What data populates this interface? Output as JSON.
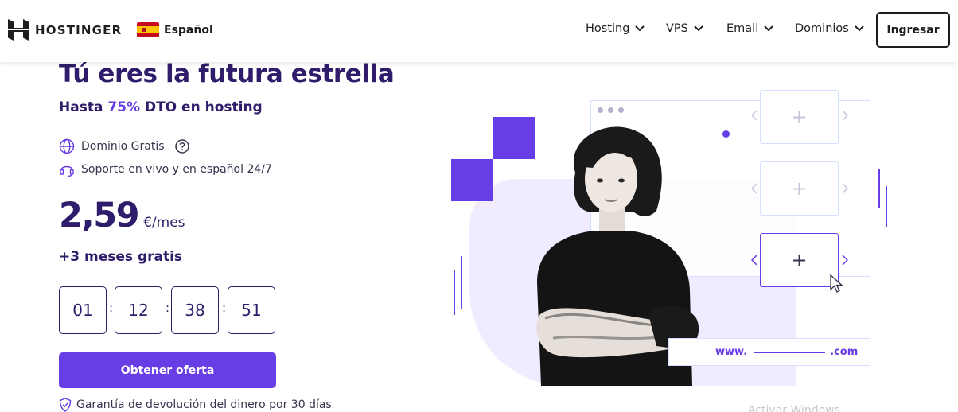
{
  "header": {
    "brand": "HOSTINGER",
    "language": "Español",
    "nav": [
      {
        "label": "Hosting"
      },
      {
        "label": "VPS"
      },
      {
        "label": "Email"
      },
      {
        "label": "Dominios"
      }
    ],
    "login_label": "Ingresar"
  },
  "hero": {
    "title": "Tú eres la futura estrella",
    "subtitle_prefix": "Hasta",
    "subtitle_discount": "75%",
    "subtitle_suffix": "DTO en hosting",
    "features": [
      {
        "label": "Dominio Gratis",
        "icon": "globe-icon",
        "has_help": true
      },
      {
        "label": "Soporte en vivo y en español 24/7",
        "icon": "headset-icon"
      }
    ],
    "price_amount": "2,59",
    "price_unit": "€/mes",
    "bonus": "+3 meses gratis",
    "countdown": [
      "01",
      "12",
      "38",
      "51"
    ],
    "cta_label": "Obtener oferta",
    "guarantee": "Garantía de devolución del dinero por 30 días"
  },
  "illustration": {
    "url_prefix": "www.",
    "url_suffix": ".com",
    "tile_symbol": "+"
  },
  "watermark": "Activar Windows",
  "colors": {
    "primary": "#673de6",
    "dark": "#2f1c6a",
    "text": "#36344d"
  }
}
